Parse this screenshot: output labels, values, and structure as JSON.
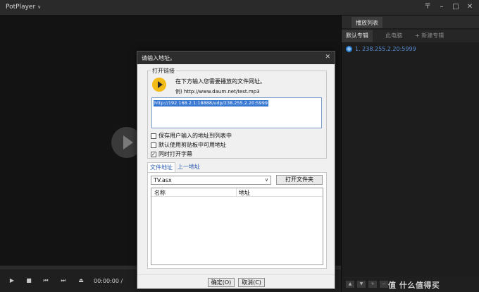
{
  "titlebar": {
    "title": "PotPlayer",
    "caret": "∨",
    "controls": {
      "pin": "〒",
      "minimize": "–",
      "maximize": "□",
      "close": "✕"
    }
  },
  "player": {
    "time": "00:00:00 /"
  },
  "playlist": {
    "title": "播放列表",
    "tabs": [
      {
        "label": "默认专辑",
        "active": true
      },
      {
        "label": "此电脑",
        "active": false
      },
      {
        "label": "+ 新建专辑",
        "active": false
      }
    ],
    "entry": "1. 238.255.2.20:5999",
    "watermark": "值 什么值得买"
  },
  "dialog": {
    "title": "请输入地址。",
    "close": "✕",
    "group_label": "打开链接",
    "hint": "在下方输入您需要播放的文件网址。",
    "example": "例) http://www.daum.net/test.mp3",
    "url_value": "http://192.168.2.1:18888/udp/238.255.2.20:5999",
    "checkboxes": [
      {
        "label": "保存用户输入的地址到列表中",
        "checked": false
      },
      {
        "label": "默认使用剪贴板中可用地址",
        "checked": false
      },
      {
        "label": "同时打开字幕",
        "checked": true
      }
    ],
    "tabs": [
      {
        "label": "文件地址",
        "active": true
      },
      {
        "label": "上一地址",
        "active": false
      }
    ],
    "combo_value": "TV.asx",
    "combo_arrow": "∨",
    "open_folder": "打开文件夹",
    "columns": [
      "名称",
      "地址"
    ],
    "ok": "确定(O)",
    "cancel": "取消(C)"
  },
  "colors": {
    "accent_blue": "#3877d2",
    "play_yellow": "#f2bb16"
  }
}
